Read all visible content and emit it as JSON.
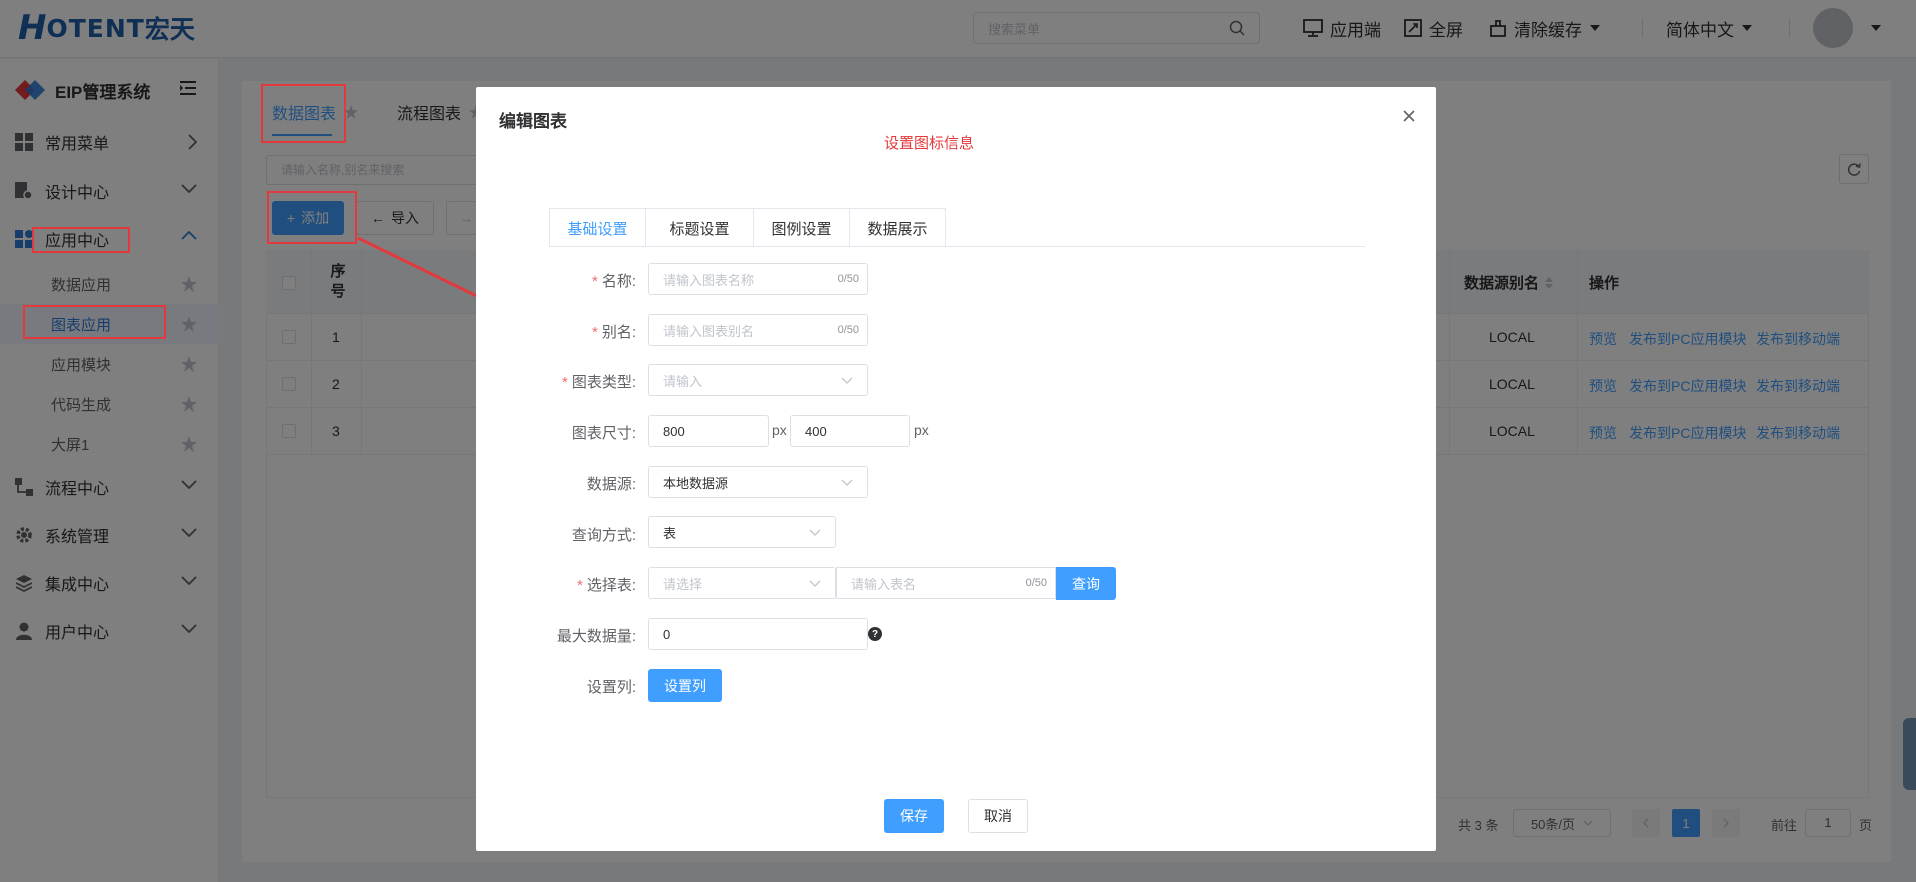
{
  "header": {
    "logo_h": "H",
    "logo_rest": "OTENT",
    "logo_cn": "宏天",
    "search_placeholder": "搜索菜单",
    "app_label": "应用端",
    "fullscreen_label": "全屏",
    "clear_cache_label": "清除缓存",
    "language_label": "简体中文"
  },
  "sidebar": {
    "system_title": "EIP管理系统",
    "menus": [
      {
        "label": "常用菜单"
      },
      {
        "label": "设计中心"
      },
      {
        "label": "应用中心"
      },
      {
        "label": "流程中心"
      },
      {
        "label": "系统管理"
      },
      {
        "label": "集成中心"
      },
      {
        "label": "用户中心"
      }
    ],
    "app_center_items": [
      {
        "label": "数据应用"
      },
      {
        "label": "图表应用"
      },
      {
        "label": "应用模块"
      },
      {
        "label": "代码生成"
      },
      {
        "label": "大屏1"
      }
    ]
  },
  "main": {
    "tabs": [
      {
        "label": "数据图表"
      },
      {
        "label": "流程图表"
      }
    ],
    "filter_placeholder": "请输入名称,别名来搜索",
    "add_label": "添加",
    "import_label": "导入",
    "table": {
      "headers": {
        "index": "序号",
        "alias": "数据源别名",
        "actions": "操作"
      },
      "rows": [
        {
          "index": "1",
          "alias": "LOCAL",
          "preview": "预览",
          "publish_pc": "发布到PC应用模块",
          "publish_mobile": "发布到移动端"
        },
        {
          "index": "2",
          "alias": "LOCAL",
          "preview": "预览",
          "publish_pc": "发布到PC应用模块",
          "publish_mobile": "发布到移动端"
        },
        {
          "index": "3",
          "alias": "LOCAL",
          "preview": "预览",
          "publish_pc": "发布到PC应用模块",
          "publish_mobile": "发布到移动端"
        }
      ]
    },
    "pagination": {
      "total": "共 3 条",
      "page_size": "50条/页",
      "current_page": "1",
      "goto_prefix": "前往",
      "goto_value": "1",
      "goto_suffix": "页"
    }
  },
  "dialog": {
    "title": "编辑图表",
    "note": "设置图标信息",
    "tabs": [
      {
        "label": "基础设置"
      },
      {
        "label": "标题设置"
      },
      {
        "label": "图例设置"
      },
      {
        "label": "数据展示"
      }
    ],
    "fields": {
      "name": {
        "label": "名称:",
        "placeholder": "请输入图表名称",
        "count": "0/50"
      },
      "alias": {
        "label": "别名:",
        "placeholder": "请输入图表别名",
        "count": "0/50"
      },
      "chart_type": {
        "label": "图表类型:",
        "placeholder": "请输入"
      },
      "chart_size": {
        "label": "图表尺寸:",
        "width": "800",
        "height": "400",
        "unit": "px"
      },
      "datasource": {
        "label": "数据源:",
        "value": "本地数据源"
      },
      "query_mode": {
        "label": "查询方式:",
        "value": "表"
      },
      "select_table": {
        "label": "选择表:",
        "select_placeholder": "请选择",
        "name_placeholder": "请输入表名",
        "count": "0/50",
        "query_label": "查询"
      },
      "max_rows": {
        "label": "最大数据量:",
        "value": "0"
      },
      "columns": {
        "label": "设置列:",
        "button_label": "设置列"
      }
    },
    "save_label": "保存",
    "cancel_label": "取消"
  },
  "colors": {
    "primary": "#409eff",
    "annotation_red": "#e4393c",
    "brand_blue": "#1e5ea8"
  }
}
